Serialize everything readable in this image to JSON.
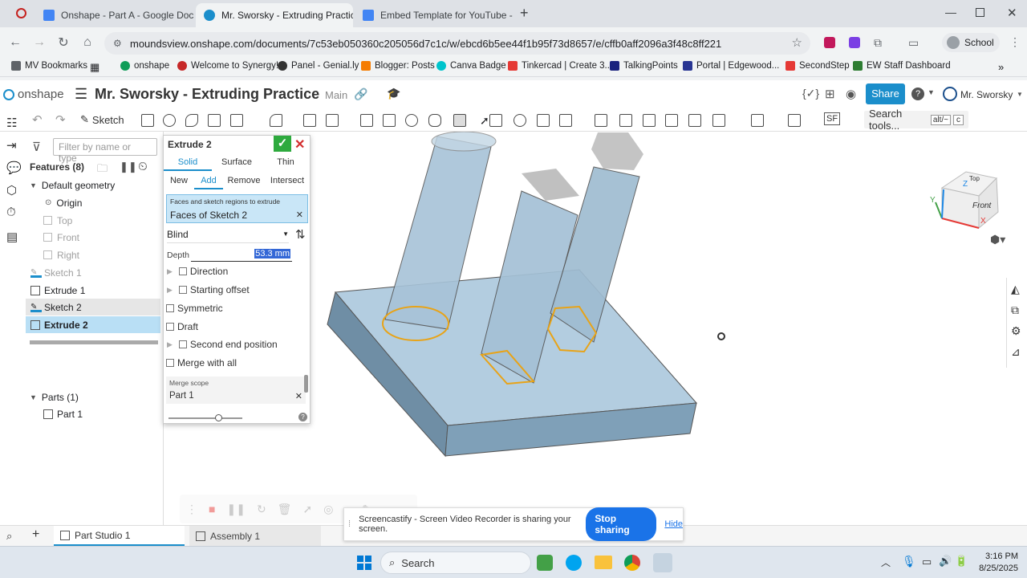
{
  "browser": {
    "tabs": [
      {
        "title": "Onshape - Part A - Google Doc",
        "fav": "#4285f4"
      },
      {
        "title": "Mr. Sworsky - Extruding Practic",
        "fav": "#1b8ecb"
      },
      {
        "title": "Embed Template for YouTube -",
        "fav": "#4285f4"
      }
    ],
    "url": "moundsview.onshape.com/documents/7c53eb050360c205056d7c1c/w/ebcd6b5ee44f1b95f73d8657/e/cffb0aff2096a3f48c8ff221",
    "profile": "School",
    "bookmarks": [
      "MV Bookmarks",
      "onshape",
      "Welcome to Synergy!",
      "Panel - Genial.ly",
      "Blogger: Posts",
      "Canva Badge",
      "Tinkercad | Create 3...",
      "TalkingPoints",
      "Portal | Edgewood...",
      "SecondStep",
      "EW Staff Dashboard"
    ]
  },
  "onshape": {
    "logo": "onshape",
    "doc_title": "Mr. Sworsky - Extruding Practice",
    "branch": "Main",
    "share": "Share",
    "user": "Mr. Sworsky",
    "sketch": "Sketch",
    "search_tools": "Search tools...",
    "shortcut": "alt/~",
    "shortcut_key": "c",
    "sf": "SF"
  },
  "features": {
    "filter_placeholder": "Filter by name or type",
    "header": "Features (8)",
    "items": [
      "Default geometry",
      "Origin",
      "Top",
      "Front",
      "Right",
      "Sketch 1",
      "Extrude 1",
      "Sketch 2",
      "Extrude 2"
    ],
    "parts_header": "Parts (1)",
    "part": "Part 1"
  },
  "dialog": {
    "title": "Extrude 2",
    "types": [
      "Solid",
      "Surface",
      "Thin"
    ],
    "ops": [
      "New",
      "Add",
      "Remove",
      "Intersect"
    ],
    "faces_label": "Faces and sketch regions to extrude",
    "faces_value": "Faces of Sketch 2",
    "end_type": "Blind",
    "depth_label": "Depth",
    "depth_value": "53.3 mm",
    "direction": "Direction",
    "starting_offset": "Starting offset",
    "symmetric": "Symmetric",
    "draft": "Draft",
    "second_end": "Second end position",
    "merge_all": "Merge with all",
    "merge_scope_label": "Merge scope",
    "merge_scope_value": "Part 1"
  },
  "viewcube": {
    "top": "Top",
    "front": "Front",
    "x": "X",
    "y": "Y",
    "z": "Z"
  },
  "bottom_tabs": [
    "Part Studio 1",
    "Assembly 1"
  ],
  "screencastify": {
    "text": "Screencastify - Screen Video Recorder is sharing your screen.",
    "stop": "Stop sharing",
    "hide": "Hide"
  },
  "taskbar": {
    "search": "Search",
    "time": "3:16 PM",
    "date": "8/25/2025"
  },
  "colors": {
    "accent": "#1b8ecb",
    "model": "#b3cde0",
    "highlight": "#e8a317",
    "selected": "#b9dff5"
  }
}
